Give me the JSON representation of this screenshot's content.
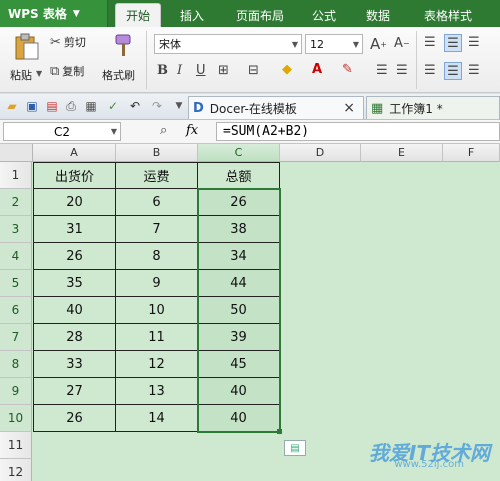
{
  "app": {
    "name": "WPS 表格"
  },
  "menu": [
    "开始",
    "插入",
    "页面布局",
    "公式",
    "数据",
    "表格样式"
  ],
  "ribbon": {
    "paste": "粘贴",
    "cut": "剪切",
    "copy": "复制",
    "format_painter": "格式刷",
    "font_name": "宋体",
    "font_size": "12"
  },
  "doc_tabs": [
    {
      "label": "Docer-在线模板",
      "close": "×"
    },
    {
      "label": "工作簿1 *"
    }
  ],
  "formula_bar": {
    "cell_ref": "C2",
    "fx": "fx",
    "formula": "=SUM(A2+B2)"
  },
  "sheet": {
    "columns": [
      "A",
      "B",
      "C",
      "D",
      "E",
      "F"
    ],
    "rows": [
      "1",
      "2",
      "3",
      "4",
      "5",
      "6",
      "7",
      "8",
      "9",
      "10",
      "11",
      "12"
    ],
    "headers": [
      "出货价",
      "运费",
      "总额"
    ],
    "data": [
      [
        "20",
        "6",
        "26"
      ],
      [
        "31",
        "7",
        "38"
      ],
      [
        "26",
        "8",
        "34"
      ],
      [
        "35",
        "9",
        "44"
      ],
      [
        "40",
        "10",
        "50"
      ],
      [
        "28",
        "11",
        "39"
      ],
      [
        "33",
        "12",
        "45"
      ],
      [
        "27",
        "13",
        "40"
      ],
      [
        "26",
        "14",
        "40"
      ]
    ],
    "selected_range": "C2:C10"
  },
  "watermark": {
    "text": "我爱IT技术网",
    "url": "www.52ij.com"
  },
  "colors": {
    "accent": "#2e7a33",
    "selection": "#2c7a36",
    "sheet_bg": "#cfe8d0"
  }
}
